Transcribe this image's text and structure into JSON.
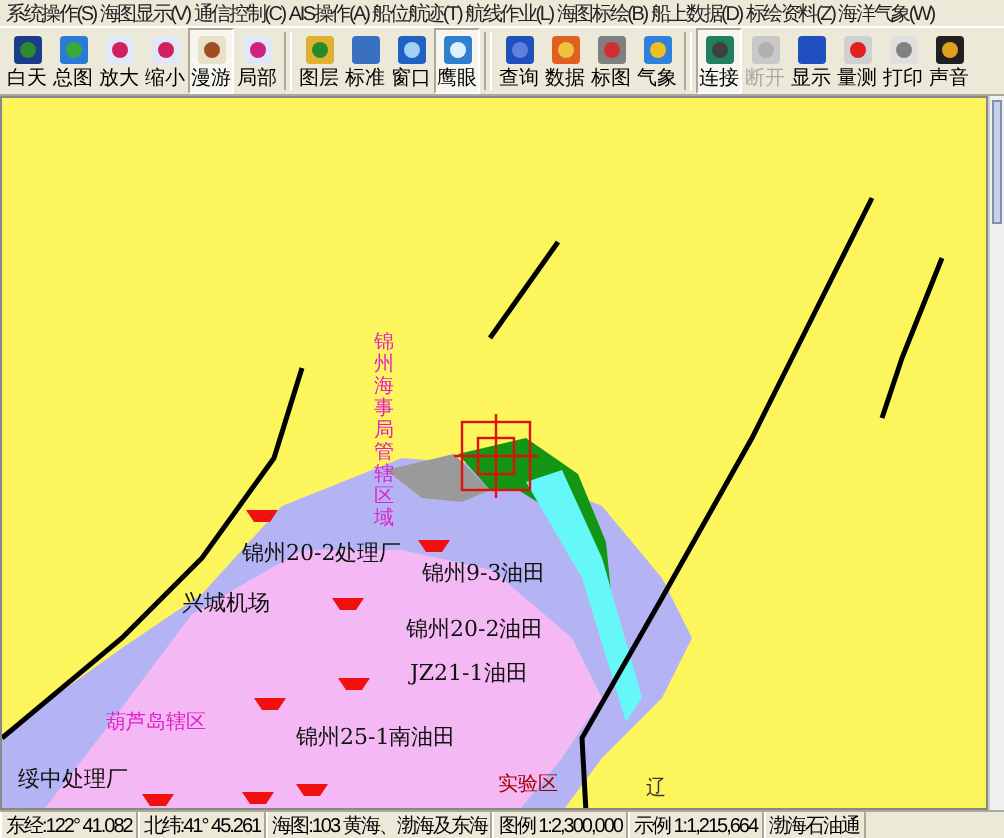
{
  "menu": [
    "系统操作(S)",
    "海图显示(V)",
    "通信控制(C)",
    "AIS操作(A)",
    "船位航迹(T)",
    "航线作业(L)",
    "海图标绘(B)",
    "船上数据(D)",
    "标绘资料(Z)",
    "海洋气象(W)"
  ],
  "toolbar": [
    [
      {
        "label": "白天",
        "pressed": false,
        "disabled": false
      },
      {
        "label": "总图",
        "pressed": false,
        "disabled": false
      },
      {
        "label": "放大",
        "pressed": false,
        "disabled": false
      },
      {
        "label": "缩小",
        "pressed": false,
        "disabled": false
      },
      {
        "label": "漫游",
        "pressed": true,
        "disabled": false
      },
      {
        "label": "局部",
        "pressed": false,
        "disabled": false
      }
    ],
    [
      {
        "label": "图层",
        "pressed": false,
        "disabled": false
      },
      {
        "label": "标准",
        "pressed": false,
        "disabled": false
      },
      {
        "label": "窗口",
        "pressed": false,
        "disabled": false
      },
      {
        "label": "鹰眼",
        "pressed": true,
        "disabled": false
      }
    ],
    [
      {
        "label": "查询",
        "pressed": false,
        "disabled": false
      },
      {
        "label": "数据",
        "pressed": false,
        "disabled": false
      },
      {
        "label": "标图",
        "pressed": false,
        "disabled": false
      },
      {
        "label": "气象",
        "pressed": false,
        "disabled": false
      }
    ],
    [
      {
        "label": "连接",
        "pressed": true,
        "disabled": false
      },
      {
        "label": "断开",
        "pressed": false,
        "disabled": true
      },
      {
        "label": "显示",
        "pressed": false,
        "disabled": false
      },
      {
        "label": "量测",
        "pressed": false,
        "disabled": false
      },
      {
        "label": "打印",
        "pressed": false,
        "disabled": false
      },
      {
        "label": "声音",
        "pressed": false,
        "disabled": false
      }
    ]
  ],
  "map": {
    "labels": [
      {
        "text": "锦州海事局管辖区域",
        "kind": "vzone"
      },
      {
        "text": "锦州20-2处理厂",
        "kind": "place"
      },
      {
        "text": "锦州9-3油田",
        "kind": "place"
      },
      {
        "text": "兴城机场",
        "kind": "place"
      },
      {
        "text": "锦州20-2油田",
        "kind": "place"
      },
      {
        "text": "JZ21-1油田",
        "kind": "place"
      },
      {
        "text": "葫芦岛辖区",
        "kind": "zone"
      },
      {
        "text": "锦州25-1南油田",
        "kind": "place"
      },
      {
        "text": "绥中处理厂",
        "kind": "place"
      },
      {
        "text": "实验区",
        "kind": "area"
      },
      {
        "text": "辽",
        "kind": "small"
      }
    ]
  },
  "status_bar": [
    "东经:122° 41.082",
    "北纬:41° 45.261",
    "海图:103 黄海、渤海及东海",
    "图例 1:2,300,000",
    "示例 1:1,215,664",
    "渤海石油通"
  ]
}
